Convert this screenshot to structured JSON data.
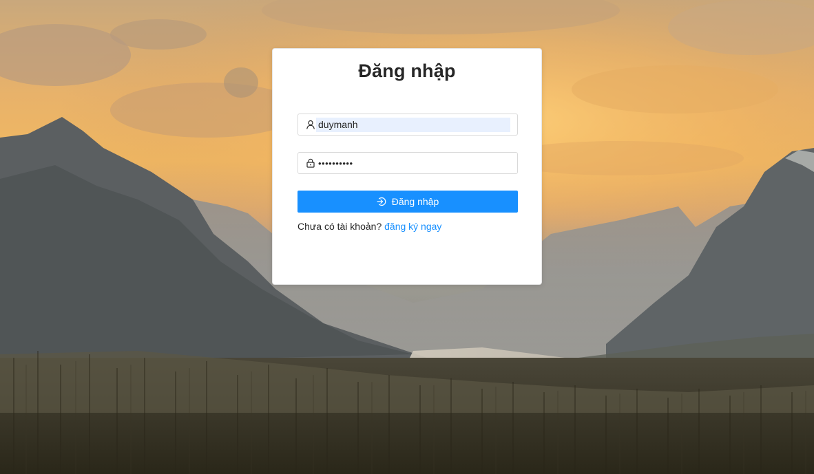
{
  "login": {
    "title": "Đăng nhập",
    "username_value": "duymanh",
    "password_value": "••••••••••",
    "submit_label": "Đăng nhập",
    "register_prompt": "Chưa có tài khoản?",
    "register_link": "đăng ký ngay"
  },
  "icons": {
    "username": "user-icon",
    "password": "lock-icon",
    "submit": "login-icon"
  },
  "colors": {
    "primary": "#1890ff",
    "autofill": "#e8f0fe",
    "title": "#262626",
    "card_background": "#ffffff"
  }
}
